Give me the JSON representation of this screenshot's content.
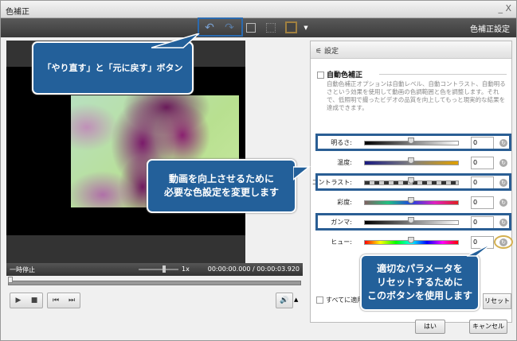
{
  "window": {
    "title": "色補正",
    "controls": "_ X"
  },
  "toolbar": {
    "title": "色補正設定",
    "undo_icon": "undo-icon",
    "redo_icon": "redo-icon"
  },
  "player": {
    "state": "一時停止",
    "speed": "1x",
    "time": "00:00:00.000 / 00:00:03.920"
  },
  "panel": {
    "header": "設定",
    "auto_label": "自動色補正",
    "auto_desc": "自動色補正オプションは自動レベル、自動コントラスト、自動明るさという効果を使用して動画の色調範囲と色を調整します。それで、低照明で撮ったビデオの品質を向上してもっと現実的な結果を達成できます。",
    "sliders": [
      {
        "label": "明るさ:",
        "value": "0"
      },
      {
        "label": "温度:",
        "value": "0"
      },
      {
        "label": "コントラスト:",
        "value": "0"
      },
      {
        "label": "彩度:",
        "value": "0"
      },
      {
        "label": "ガンマ:",
        "value": "0"
      },
      {
        "label": "ヒュー:",
        "value": "0"
      }
    ],
    "apply_all": "すべてに適用",
    "reset": "リセット"
  },
  "footer": {
    "ok": "はい",
    "cancel": "キャンセル"
  },
  "callouts": {
    "undo_redo": "「やり直す」と「元に戻す」ボタン",
    "color": "動画を向上させるために\n必要な色設定を変更します",
    "reset": "適切なパラメータを\nリセットするために\nこのボタンを使用します"
  }
}
